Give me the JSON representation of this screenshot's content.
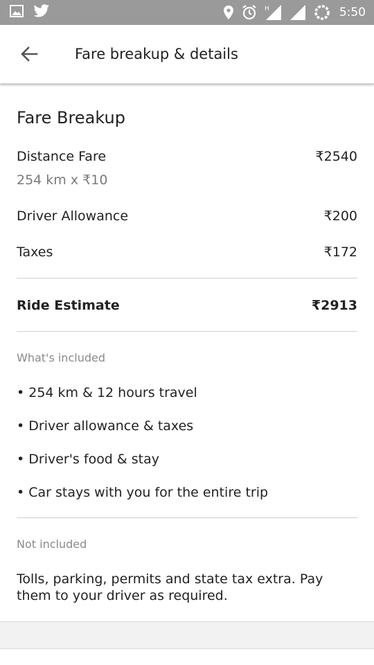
{
  "status_bar": {
    "time": "5:50",
    "icons": [
      "image-icon",
      "twitter-icon",
      "location-icon",
      "alarm-icon",
      "signal-h-icon",
      "signal-icon",
      "battery-loading-icon"
    ]
  },
  "app_bar": {
    "title": "Fare breakup & details",
    "back_icon": "arrow-left-icon"
  },
  "fare_breakup": {
    "title": "Fare Breakup",
    "distance": {
      "label": "Distance Fare",
      "amount": "₹2540",
      "detail": "254 km x ₹10"
    },
    "driver_allowance": {
      "label": "Driver Allowance",
      "amount": "₹200"
    },
    "taxes": {
      "label": "Taxes",
      "amount": "₹172"
    },
    "estimate": {
      "label": "Ride Estimate",
      "amount": "₹2913"
    }
  },
  "included": {
    "title": "What's included",
    "items": [
      "• 254 km & 12 hours travel",
      "• Driver allowance & taxes",
      "• Driver's food & stay",
      "• Car stays with you for the entire trip"
    ]
  },
  "not_included": {
    "title": "Not included",
    "text": "Tolls, parking, permits and state tax extra. Pay them to your driver as required."
  }
}
